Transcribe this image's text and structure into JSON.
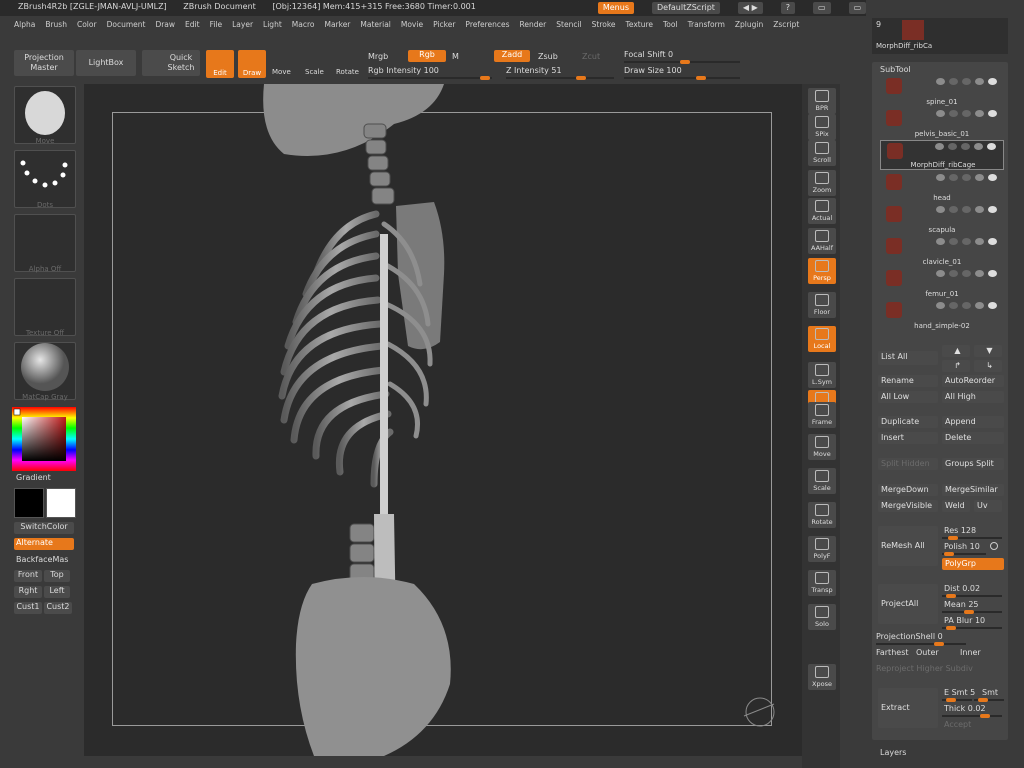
{
  "titlebar": {
    "app": "ZBrush4R2b [ZGLE-JMAN-AVLJ-UMLZ]",
    "doc": "ZBrush Document",
    "obj": "[Obj:12364] Mem:415+315 Free:3680 Timer:0.001",
    "menus_btn": "Menus",
    "script_btn": "DefaultZScript"
  },
  "menubar": [
    "Alpha",
    "Brush",
    "Color",
    "Document",
    "Draw",
    "Edit",
    "File",
    "Layer",
    "Light",
    "Macro",
    "Marker",
    "Material",
    "Movie",
    "Picker",
    "Preferences",
    "Render",
    "Stencil",
    "Stroke",
    "Texture",
    "Tool",
    "Transform",
    "Zplugin",
    "Zscript"
  ],
  "topshelf": {
    "projection_master": "Projection Master",
    "lightbox": "LightBox",
    "quick_sketch": "Quick Sketch",
    "edit": "Edit",
    "draw": "Draw",
    "move": "Move",
    "scale": "Scale",
    "rotate": "Rotate",
    "mrgb": "Mrgb",
    "rgb": "Rgb",
    "m": "M",
    "rgb_intensity": "Rgb Intensity 100",
    "zadd": "Zadd",
    "zsub": "Zsub",
    "zcut": "Zcut",
    "z_intensity": "Z Intensity 51",
    "focal_shift": "Focal Shift 0",
    "draw_size": "Draw Size 100"
  },
  "leftpanel": {
    "brush_cap": "Move",
    "stroke_cap": "Dots",
    "alpha_cap": "Alpha Off",
    "texture_cap": "Texture Off",
    "material_cap": "MatCap Gray",
    "gradient": "Gradient",
    "switchcolor": "SwitchColor",
    "alternate": "Alternate",
    "backface": "BackfaceMas",
    "front": "Front",
    "top": "Top",
    "right": "Rght",
    "left": "Left",
    "cust1": "Cust1",
    "cust2": "Cust2"
  },
  "rightshelf": [
    "BPR",
    "SPix",
    "Scroll",
    "Zoom",
    "Actual",
    "AAHalf",
    "Persp",
    "Floor",
    "Local",
    "L.Sym",
    "XYZ",
    "Frame",
    "Move",
    "Scale",
    "Rotate",
    "PolyF",
    "Transp",
    "Solo",
    "Xpose"
  ],
  "sidepanel": {
    "tool_count": "9",
    "tool_name": "MorphDiff_ribCa",
    "subtool_title": "SubTool",
    "subtools": [
      "spine_01",
      "pelvis_basic_01",
      "MorphDiff_ribCage",
      "head",
      "scapula",
      "clavicle_01",
      "femur_01",
      "hand_simple-02"
    ],
    "list_all": "List All",
    "rename": "Rename",
    "autoreorder": "AutoReorder",
    "all_low": "All Low",
    "all_high": "All High",
    "duplicate": "Duplicate",
    "append": "Append",
    "insert": "Insert",
    "delete": "Delete",
    "split_hidden": "Split Hidden",
    "groups_split": "Groups Split",
    "mergedown": "MergeDown",
    "mergesimilar": "MergeSimilar",
    "mergevisible": "MergeVisible",
    "weld": "Weld",
    "uv": "Uv",
    "remesh_all": "ReMesh All",
    "res": "Res 128",
    "polish": "Polish 10",
    "polygrp": "PolyGrp",
    "project_all": "ProjectAll",
    "dist": "Dist 0.02",
    "mean": "Mean 25",
    "pa_blur": "PA Blur 10",
    "projection_shell": "ProjectionShell 0",
    "farthest": "Farthest",
    "outer": "Outer",
    "inner": "Inner",
    "reproject": "Reproject Higher Subdiv",
    "extract": "Extract",
    "e_smt": "E Smt 5",
    "s_smt": "Smt",
    "thick": "Thick 0.02",
    "accept": "Accept",
    "layers": "Layers"
  },
  "colors": {
    "accent": "#e7781b",
    "panel": "#3a3a3a",
    "canvas": "#2b2b2b"
  }
}
